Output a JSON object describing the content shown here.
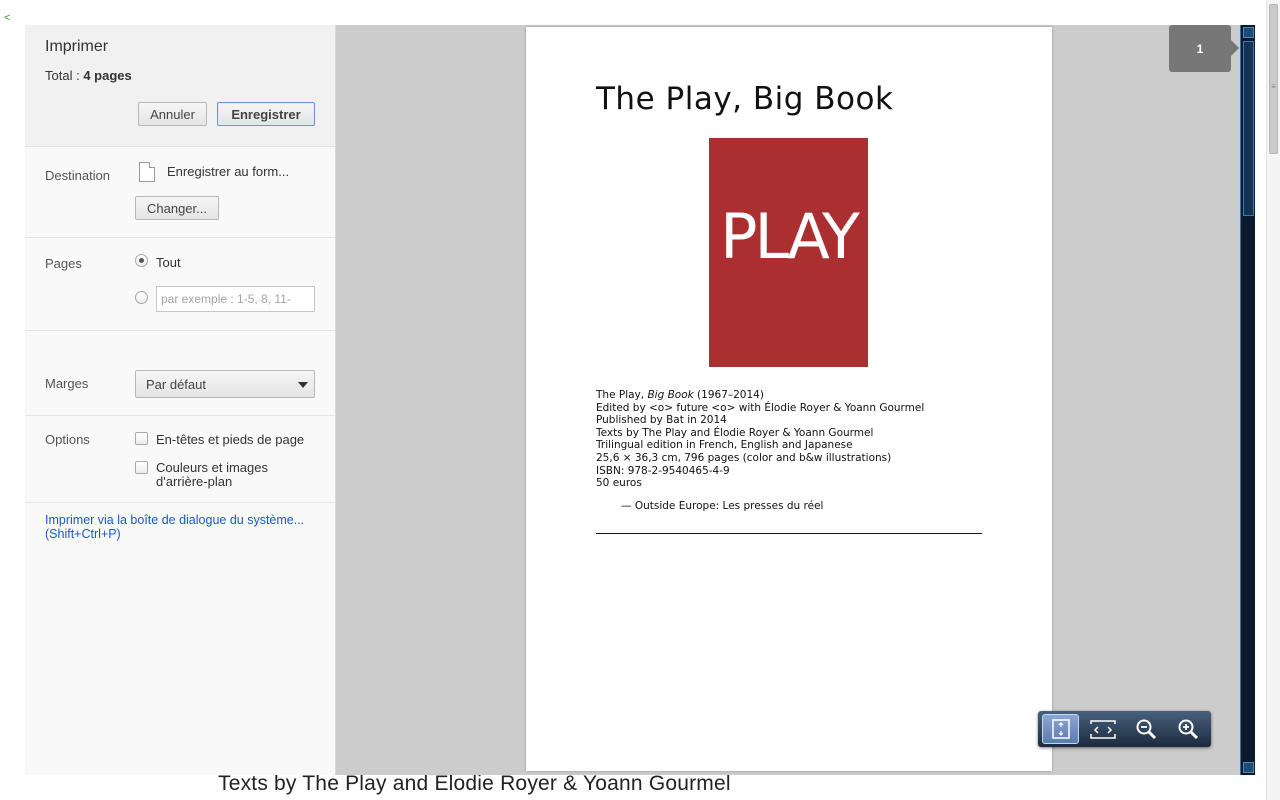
{
  "window": {
    "back_glyph": "<",
    "underlying_text": "Texts by The Play and Élodie Royer & Yoann Gourmel"
  },
  "sidebar": {
    "title": "Imprimer",
    "total_label": "Total :",
    "total_value": "4 pages",
    "cancel_label": "Annuler",
    "save_label": "Enregistrer",
    "destination": {
      "label": "Destination",
      "value": "Enregistrer au form...",
      "change_label": "Changer..."
    },
    "pages": {
      "label": "Pages",
      "all_label": "Tout",
      "range_placeholder": "par exemple : 1-5, 8, 11-",
      "selected": "all"
    },
    "margins": {
      "label": "Marges",
      "value": "Par défaut"
    },
    "options": {
      "label": "Options",
      "headers_footers": "En-têtes et pieds de page",
      "bg_line1": "Couleurs et images",
      "bg_line2": "d'arrière-plan"
    },
    "system_dialog_link": "Imprimer via la boîte de dialogue du système...",
    "system_dialog_shortcut": "(Shift+Ctrl+P)"
  },
  "preview": {
    "page_number": "1",
    "title": "The Play, Big Book",
    "cover_text": "PLAY",
    "cover_color": "#ab2f31",
    "line1_prefix": "The Play, ",
    "line1_italic": "Big Book",
    "line1_suffix": " (1967–2014)",
    "line2": "Edited by <o> future <o> with Élodie Royer & Yoann Gourmel",
    "line3": "Published by Bat in 2014",
    "line4": "Texts by The Play and Élodie Royer & Yoann Gourmel",
    "line5": "Trilingual edition in French, English and Japanese",
    "line6": "25,6 × 36,3 cm, 796 pages (color and b&w illustrations)",
    "line7": "ISBN: 978-2-9540465-4-9",
    "line8": "50 euros",
    "outside": "— Outside Europe: Les presses du réel"
  },
  "zoom_controls": [
    "fit-page-icon",
    "fit-width-icon",
    "zoom-out-icon",
    "zoom-in-icon"
  ]
}
